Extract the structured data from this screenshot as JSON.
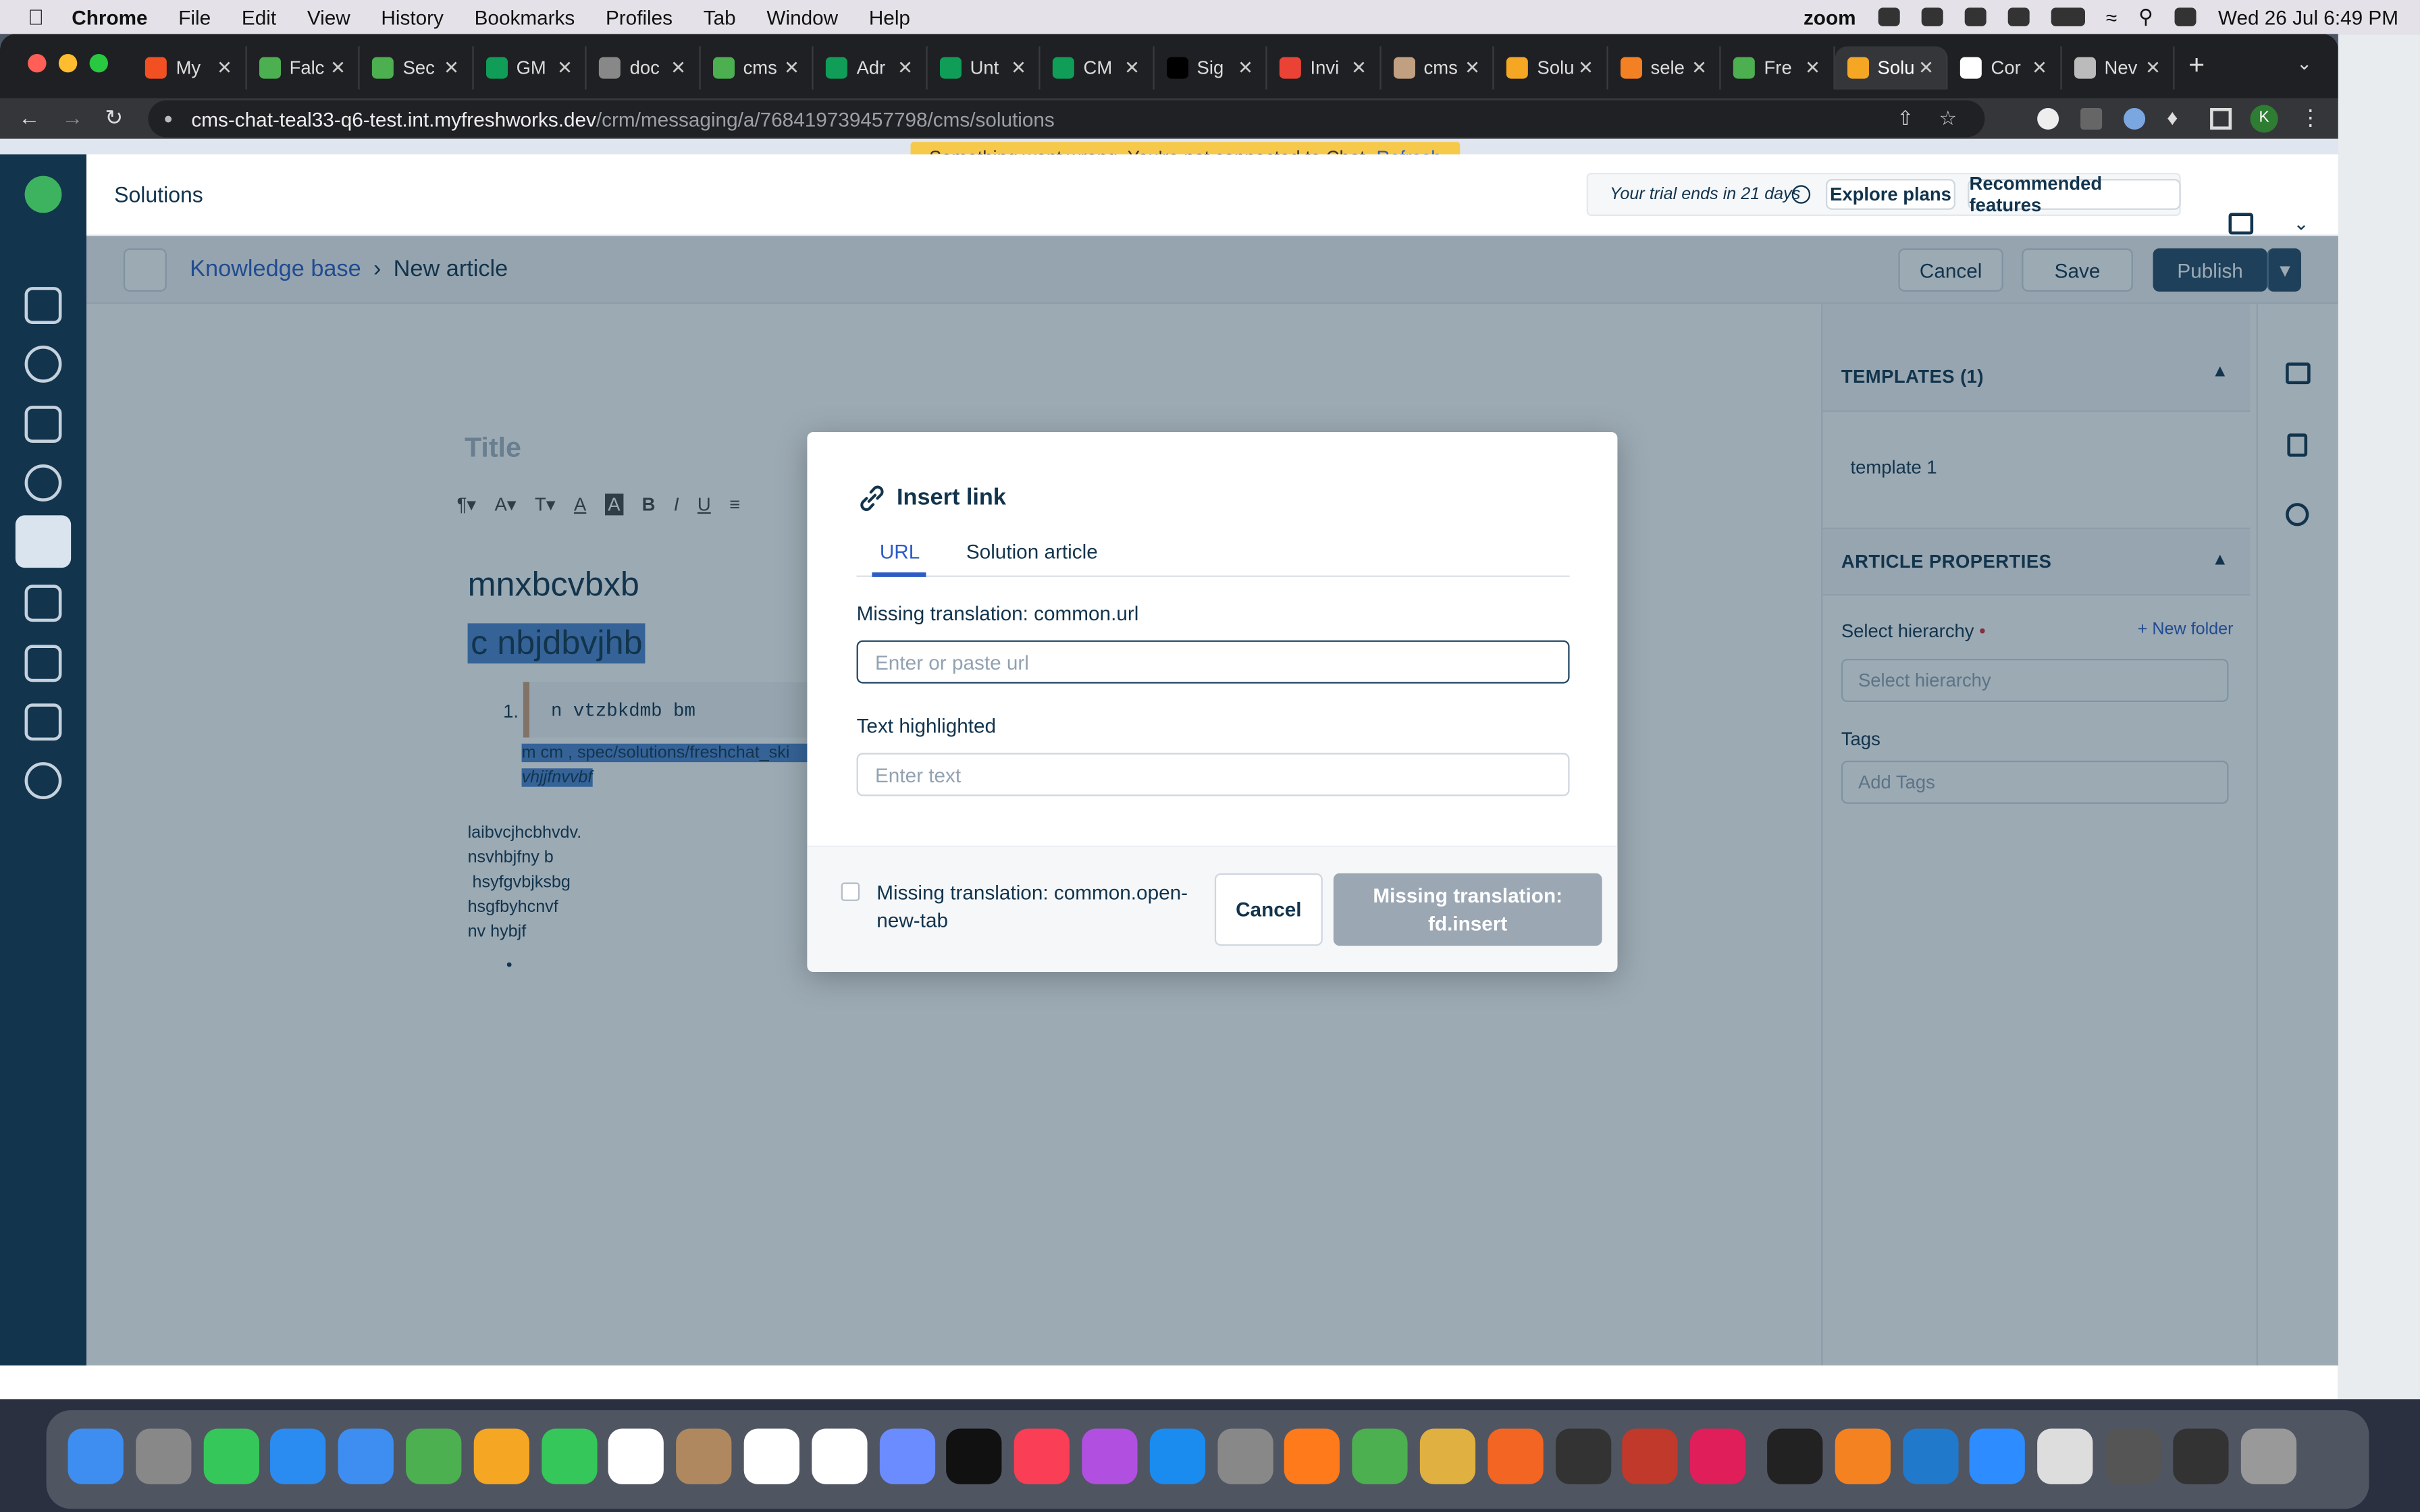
{
  "menubar": {
    "app": "Chrome",
    "items": [
      "File",
      "Edit",
      "View",
      "History",
      "Bookmarks",
      "Profiles",
      "Tab",
      "Window",
      "Help"
    ],
    "status_app": "zoom",
    "datetime": "Wed 26 Jul  6:49 PM"
  },
  "browser": {
    "tabs": [
      {
        "label": "My",
        "color": "#f25022"
      },
      {
        "label": "Falc",
        "color": "#4caf50"
      },
      {
        "label": "Sec",
        "color": "#4caf50"
      },
      {
        "label": "GM",
        "color": "#0f9d58"
      },
      {
        "label": "doc",
        "color": "#888888"
      },
      {
        "label": "cms",
        "color": "#4caf50"
      },
      {
        "label": "Adr",
        "color": "#0f9d58"
      },
      {
        "label": "Unt",
        "color": "#0f9d58"
      },
      {
        "label": "CM",
        "color": "#0f9d58"
      },
      {
        "label": "Sig",
        "color": "#000000"
      },
      {
        "label": "Invi",
        "color": "#ea4335"
      },
      {
        "label": "cms",
        "color": "#c0a080"
      },
      {
        "label": "Solu",
        "color": "#f5a623"
      },
      {
        "label": "sele",
        "color": "#f48024"
      },
      {
        "label": "Fre",
        "color": "#4caf50"
      },
      {
        "label": "Solu",
        "color": "#f5a623"
      },
      {
        "label": "Cor",
        "color": "#ffffff"
      },
      {
        "label": "Nev",
        "color": "#bbbbbb"
      }
    ],
    "active_tab_index": 15,
    "url_host": "cms-chat-teal33-q6-test.int.myfreshworks.dev",
    "url_path": "/crm/messaging/a/768419739457798/cms/solutions"
  },
  "banner": {
    "message": "Something went wrong. You're not connected to Chat.",
    "action": "Refresh"
  },
  "header": {
    "title": "Solutions",
    "trial_text": "Your trial ends in 21 days",
    "explore_plans": "Explore plans",
    "recommended": "Recommended features"
  },
  "subheader": {
    "breadcrumb_root": "Knowledge base",
    "breadcrumb_current": "New article",
    "cancel": "Cancel",
    "save": "Save",
    "publish": "Publish"
  },
  "editor": {
    "title_placeholder": "Title",
    "heading1": "mnxbcvbxb",
    "heading2": "c nbjdbvjhb",
    "list_item": "n vtzbkdmb bm",
    "link_text_1": "m cm , spec/solutions/freshchat_ski",
    "link_text_2": "vhjjfnvvbf",
    "lines": [
      "laibvcjhcbhvdv.",
      "nsvhbjfny b",
      " hsyfgvbjksbg",
      "hsgfbyhcnvf",
      "nv hybjf"
    ]
  },
  "right_panel": {
    "templates_header": "TEMPLATES (1)",
    "template_item": "template 1",
    "properties_header": "ARTICLE PROPERTIES",
    "hierarchy_label": "Select hierarchy",
    "new_folder": "+ New folder",
    "hierarchy_placeholder": "Select hierarchy",
    "tags_label": "Tags",
    "tags_placeholder": "Add Tags"
  },
  "modal": {
    "title": "Insert link",
    "tab_url": "URL",
    "tab_solution": "Solution article",
    "url_label": "Missing translation: common.url",
    "url_placeholder": "Enter or paste url",
    "text_label": "Text highlighted",
    "text_placeholder": "Enter text",
    "open_new_tab": "Missing translation: common.open-new-tab",
    "cancel": "Cancel",
    "insert": "Missing translation: fd.insert"
  },
  "colors": {
    "primary": "#2c5cc5",
    "nav_bg": "#12344d",
    "publish": "#264966",
    "toast": "#f7c94b"
  }
}
